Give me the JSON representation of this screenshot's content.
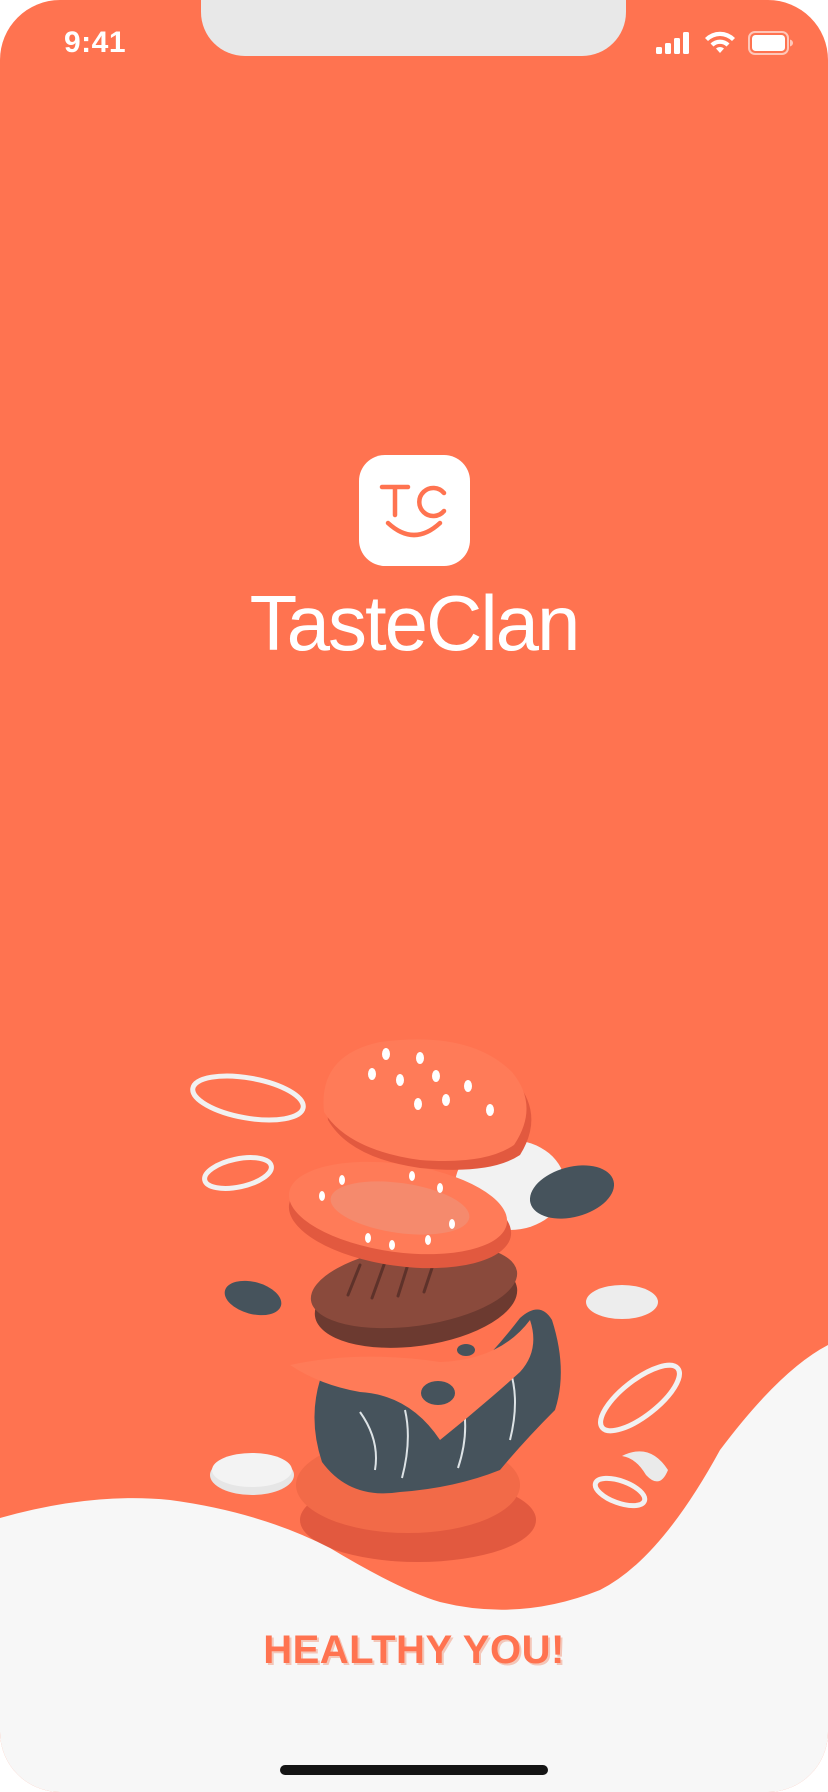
{
  "status_bar": {
    "time": "9:41",
    "icons": [
      "cellular-signal-icon",
      "wifi-icon",
      "battery-icon"
    ]
  },
  "logo": {
    "monogram": "TC",
    "brand_name": "TasteClan"
  },
  "illustration": {
    "subject": "burger-ingredients-icon"
  },
  "tagline": "HEALTHY YOU!",
  "colors": {
    "primary": "#FF7350",
    "background_bottom": "#F7F7F7",
    "dark_accent": "#46535C",
    "patty": "#7A4236"
  }
}
